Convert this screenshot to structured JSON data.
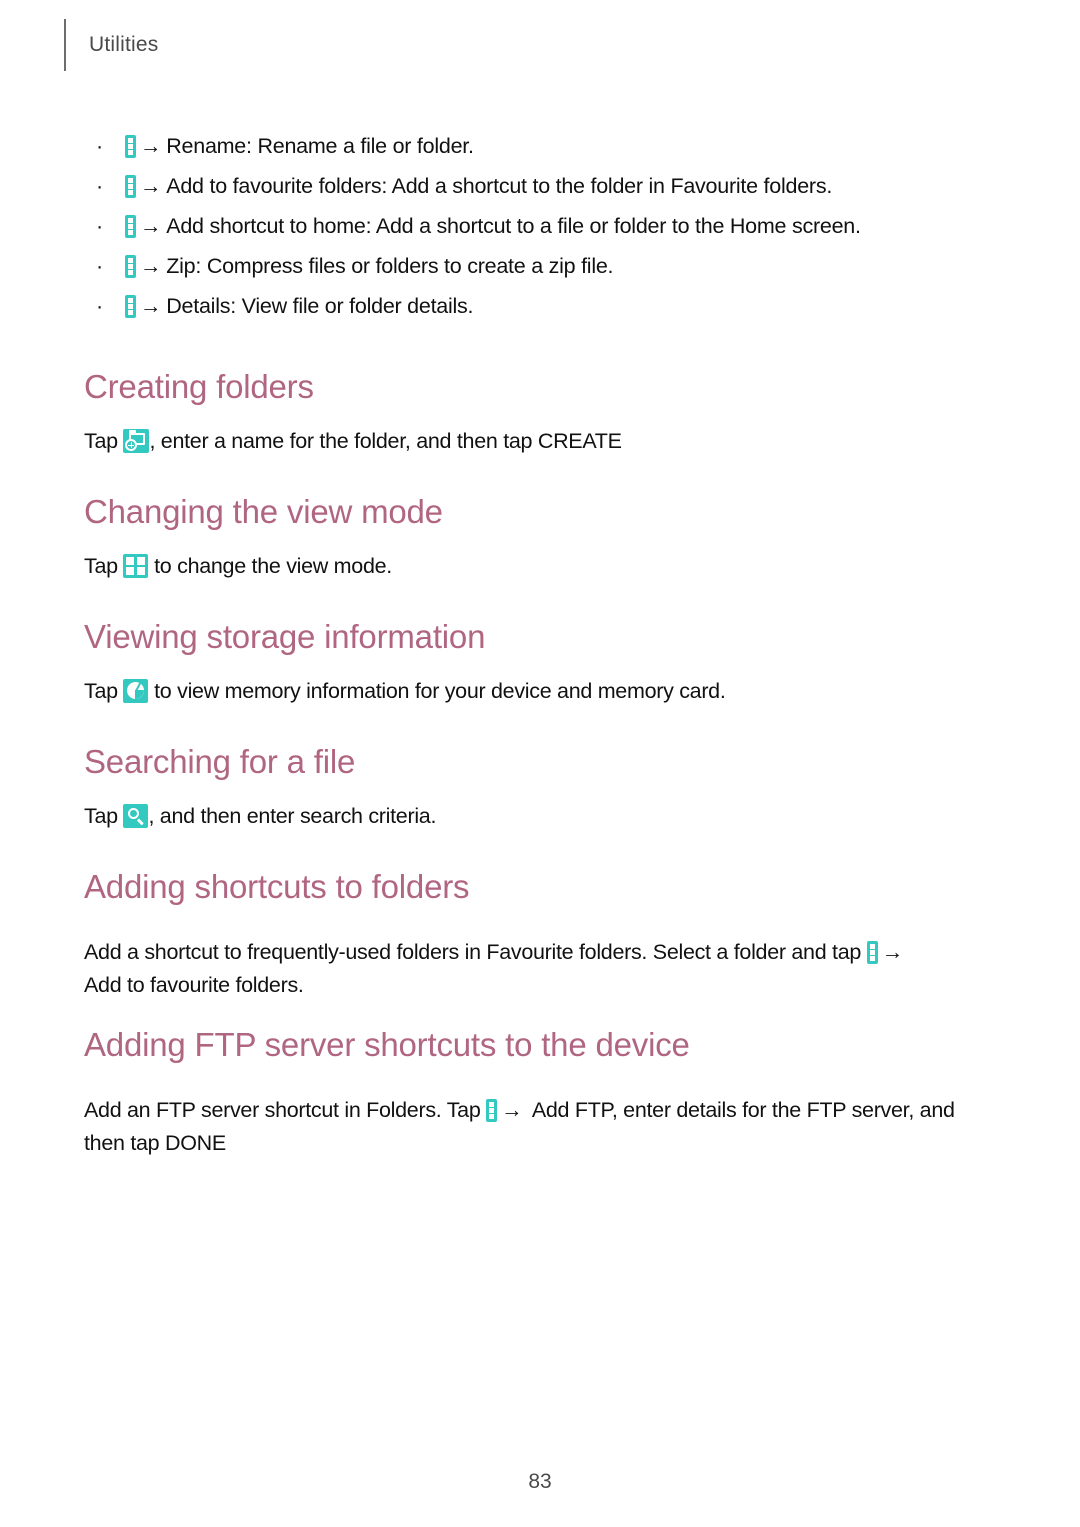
{
  "running_head": {
    "label": "Utilities"
  },
  "colors": {
    "heading": "#b06581",
    "icon_teal": "#33c9c1",
    "body_text": "#111111",
    "running_head_text": "#4a4a4a"
  },
  "bullets": [
    {
      "icon": "more-options-icon",
      "arrow": "→",
      "text": "Rename: Rename a file or folder."
    },
    {
      "icon": "more-options-icon",
      "arrow": "→",
      "text": "Add to favourite folders: Add a shortcut to the folder in Favourite folders."
    },
    {
      "icon": "more-options-icon",
      "arrow": "→",
      "text": "Add shortcut to home: Add a shortcut to a file or folder to the Home screen."
    },
    {
      "icon": "more-options-icon",
      "arrow": "→",
      "text": "Zip: Compress files or folders to create a zip file."
    },
    {
      "icon": "more-options-icon",
      "arrow": "→",
      "text": "Details: View file or folder details."
    }
  ],
  "sections": [
    {
      "id": "creating-folders",
      "heading": "Creating folders",
      "icon": "new-folder-icon",
      "before_icon": "Tap ",
      "after_icon": ", enter a name for the folder, and then tap CREATE"
    },
    {
      "id": "changing-the-view-mode",
      "heading": "Changing the view mode",
      "icon": "grid-view-icon",
      "before_icon": "Tap ",
      "after_icon": " to change the view mode."
    },
    {
      "id": "viewing-storage-information",
      "heading": "Viewing storage information",
      "icon": "storage-pie-icon",
      "before_icon": "Tap ",
      "after_icon": " to view memory information for your device and memory card."
    },
    {
      "id": "searching-for-a-file",
      "heading": "Searching for a file",
      "icon": "search-icon",
      "before_icon": "Tap ",
      "after_icon": ", and then enter search criteria."
    },
    {
      "id": "adding-shortcuts-to-folders",
      "heading": "Adding shortcuts to folders",
      "icon": "more-options-icon",
      "before_icon": "Add a shortcut to frequently-used folders in Favourite folders. Select a folder and tap ",
      "arrow": "→",
      "after_icon": "",
      "line2": "Add to favourite folders."
    },
    {
      "id": "adding-ftp-server-shortcuts-to-the-device",
      "heading": "Adding FTP server shortcuts to the device",
      "icon": "more-options-icon",
      "before_icon": "Add an FTP server shortcut in Folders. Tap ",
      "arrow": "→",
      "after_icon": " Add FTP, enter details for the FTP server, and",
      "line2": "then tap DONE"
    }
  ],
  "footer": {
    "page_number": "83"
  }
}
